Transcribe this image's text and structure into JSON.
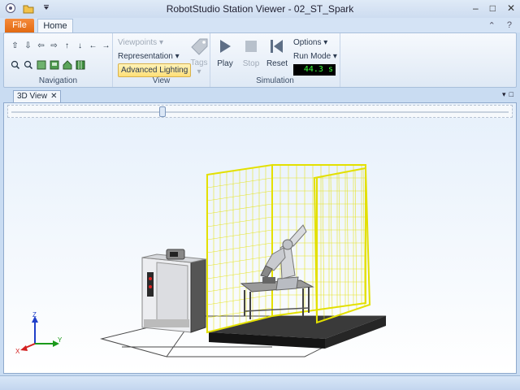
{
  "window": {
    "title": "RobotStudio Station Viewer - 02_ST_Spark"
  },
  "tabs": {
    "file": "File",
    "home": "Home"
  },
  "ribbon": {
    "navigation": {
      "label": "Navigation"
    },
    "view": {
      "label": "View",
      "viewpoints": "Viewpoints",
      "representation": "Representation",
      "advanced_lighting": "Advanced Lighting",
      "tags": "Tags"
    },
    "simulation": {
      "label": "Simulation",
      "play": "Play",
      "stop": "Stop",
      "reset": "Reset",
      "options": "Options",
      "run_mode": "Run Mode",
      "time": "44.3 s"
    }
  },
  "document": {
    "tab": "3D View"
  },
  "axes": {
    "x": "X",
    "y": "Y",
    "z": "Z"
  },
  "colors": {
    "fence": "#e3e000",
    "file_tab": "#e8741d",
    "lcd": "#3cff3c"
  }
}
